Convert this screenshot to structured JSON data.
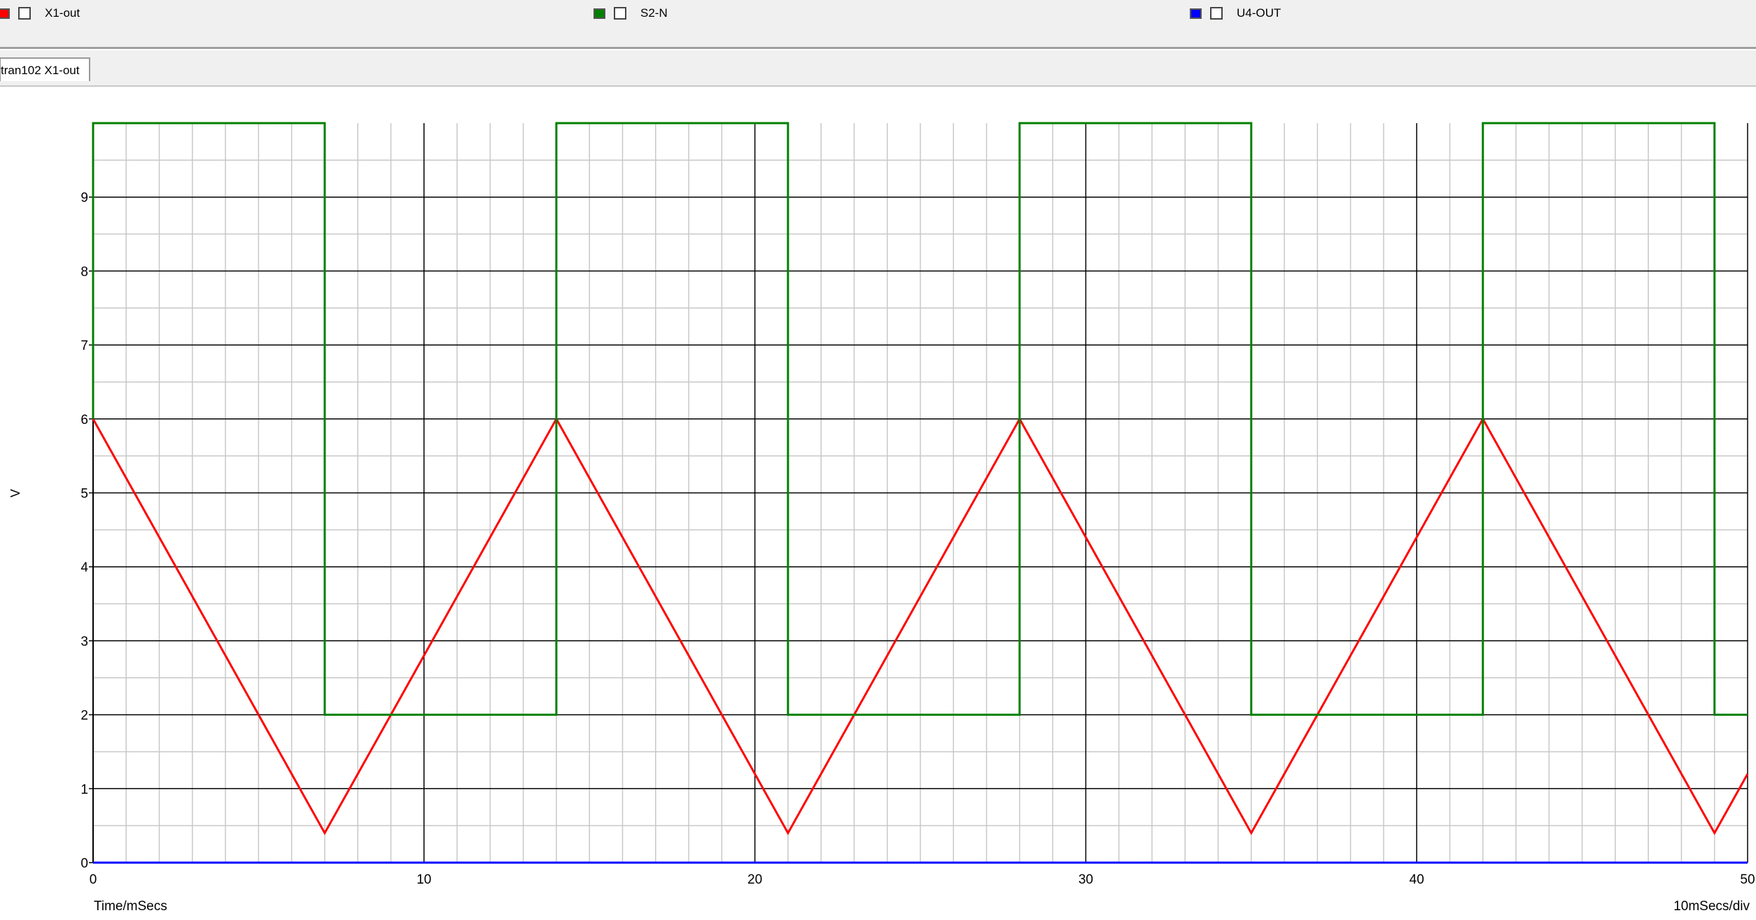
{
  "legend": [
    {
      "label": "X1-out",
      "color": "#ff0000"
    },
    {
      "label": "S2-N",
      "color": "#008000"
    },
    {
      "label": "U4-OUT",
      "color": "#0000ff"
    }
  ],
  "tab": {
    "label": "tran102 X1-out"
  },
  "chart_data": {
    "type": "line",
    "title": "",
    "xlabel": "Time/mSecs",
    "ylabel": "V",
    "scale_label": "10mSecs/div",
    "xlim": [
      0,
      50
    ],
    "ylim": [
      0,
      10
    ],
    "x_ticks": [
      0,
      10,
      20,
      30,
      40,
      50
    ],
    "y_ticks": [
      0,
      1,
      2,
      3,
      4,
      5,
      6,
      7,
      8,
      9
    ],
    "grid": true,
    "series": [
      {
        "name": "X1-out",
        "color": "#ff0000",
        "x": [
          0,
          7,
          14,
          21,
          28,
          35,
          42,
          49,
          50
        ],
        "y": [
          6,
          0.4,
          6,
          0.4,
          6,
          0.4,
          6,
          0.4,
          1.2
        ]
      },
      {
        "name": "S2-N",
        "color": "#008000",
        "x": [
          0,
          0,
          7,
          7,
          14,
          14,
          21,
          21,
          28,
          28,
          35,
          35,
          42,
          42,
          49,
          49,
          50
        ],
        "y": [
          6,
          10,
          10,
          2,
          2,
          10,
          10,
          2,
          2,
          10,
          10,
          2,
          2,
          10,
          10,
          2,
          2
        ]
      },
      {
        "name": "U4-OUT",
        "color": "#0000ff",
        "x": [
          0,
          50
        ],
        "y": [
          0,
          0
        ]
      }
    ]
  }
}
